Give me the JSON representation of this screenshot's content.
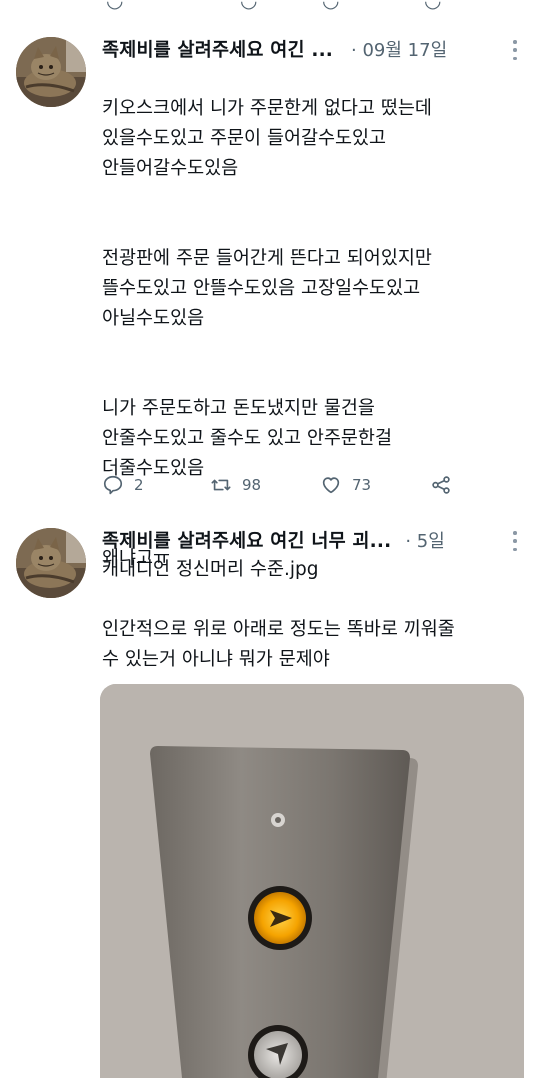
{
  "tweets": [
    {
      "author": "족제비를 살려주세요 여긴 ...",
      "time": "· 09월 17일",
      "paragraphs": [
        "키오스크에서 니가 주문한게 없다고 떴는데\n있을수도있고 주문이 들어갈수도있고\n안들어갈수도있음",
        "전광판에 주문 들어간게 뜬다고 되어있지만\n뜰수도있고 안뜰수도있음 고장일수도있고\n아닐수도있음",
        "니가 주문도하고 돈도냈지만 물건을\n안줄수도있고 줄수도 있고 안주문한걸\n더줄수도있음",
        "왜냐고ㅠ"
      ],
      "actions": {
        "replies": "2",
        "retweets": "98",
        "likes": "73"
      }
    },
    {
      "author": "족제비를 살려주세요 여긴 너무 괴...",
      "time": "· 5일",
      "text": "캐내디언 정신머리 수준.jpg\n\n인간적으로 위로 아래로 정도는 똑바로 끼워줄\n수 있는거 아니냐 뭐가 문제야"
    }
  ],
  "icons": {
    "avatar": "cat-photo-avatar",
    "more": "more-vertical-icon",
    "reply": "reply-icon",
    "retweet": "retweet-icon",
    "like": "heart-icon",
    "share": "share-icon"
  },
  "colors": {
    "text": "#0f1419",
    "secondary": "#536471",
    "elevator_button_lit": "#f5a300"
  }
}
